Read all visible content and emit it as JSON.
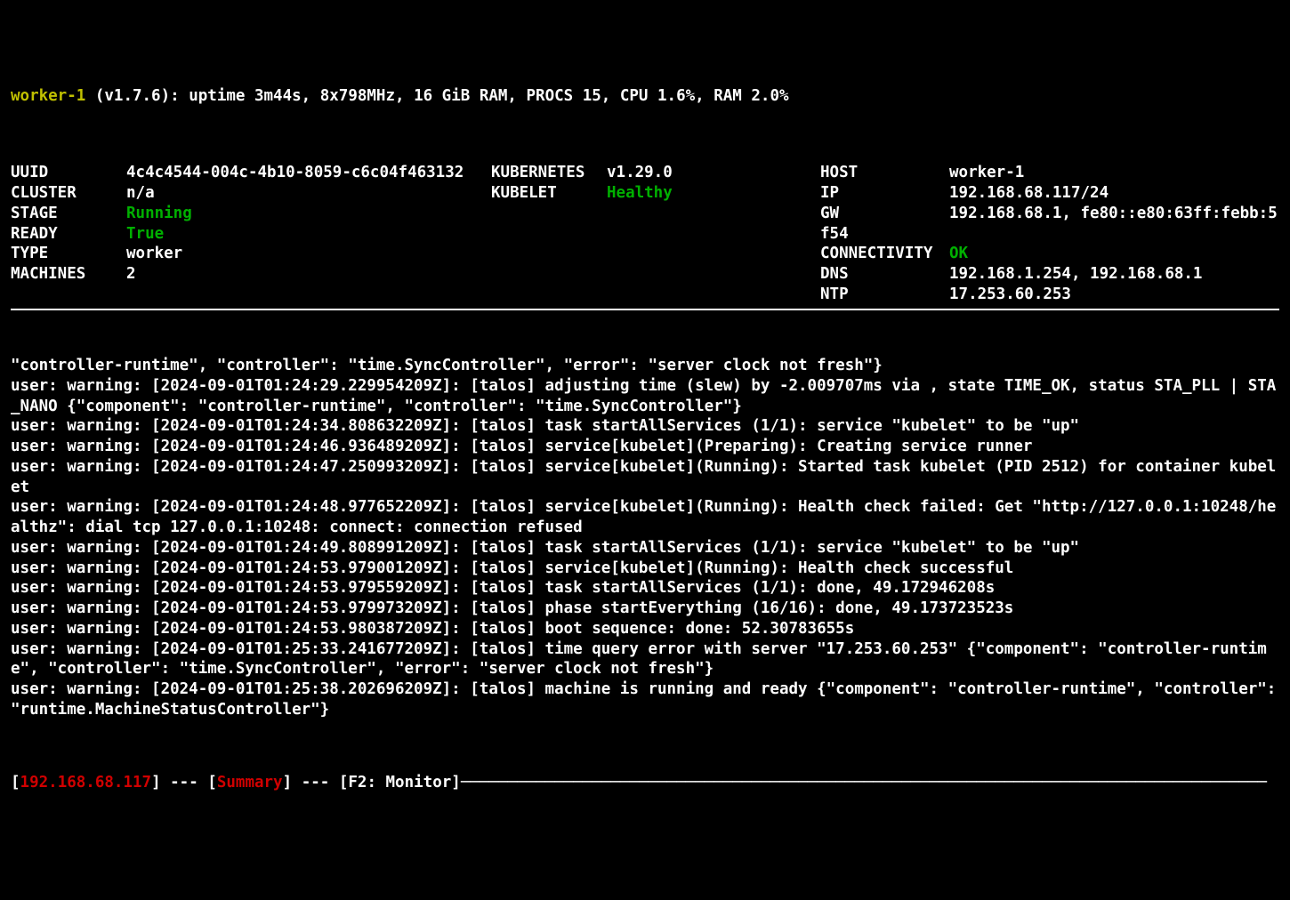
{
  "header": {
    "hostname": "worker-1",
    "version": "v1.7.6",
    "stats": ": uptime 3m44s, 8x798MHz, 16 GiB RAM, PROCS 15, CPU 1.6%, RAM 2.0%"
  },
  "col1": {
    "uuid_label": "UUID",
    "uuid_value": "4c4c4544-004c-4b10-8059-c6c04f463132",
    "cluster_label": "CLUSTER",
    "cluster_value": "n/a",
    "stage_label": "STAGE",
    "stage_value": "Running",
    "ready_label": "READY",
    "ready_value": "True",
    "type_label": "TYPE",
    "type_value": "worker",
    "machines_label": "MACHINES",
    "machines_value": "2"
  },
  "col2": {
    "k8s_label": "KUBERNETES",
    "k8s_value": "v1.29.0",
    "kubelet_label": "KUBELET",
    "kubelet_value": "Healthy"
  },
  "col3": {
    "host_label": "HOST",
    "host_value": "worker-1",
    "ip_label": "IP",
    "ip_value": "192.168.68.117/24",
    "gw_label": "GW",
    "gw_value": "192.168.68.1, fe80::e80:63ff:febb:5f54",
    "conn_label": "CONNECTIVITY",
    "conn_value": "OK",
    "dns_label": "DNS",
    "dns_value": "192.168.1.254, 192.168.68.1",
    "ntp_label": "NTP",
    "ntp_value": "17.253.60.253"
  },
  "logs": "\"controller-runtime\", \"controller\": \"time.SyncController\", \"error\": \"server clock not fresh\"}\nuser: warning: [2024-09-01T01:24:29.229954209Z]: [talos] adjusting time (slew) by -2.009707ms via , state TIME_OK, status STA_PLL | STA_NANO {\"component\": \"controller-runtime\", \"controller\": \"time.SyncController\"}\nuser: warning: [2024-09-01T01:24:34.808632209Z]: [talos] task startAllServices (1/1): service \"kubelet\" to be \"up\"\nuser: warning: [2024-09-01T01:24:46.936489209Z]: [talos] service[kubelet](Preparing): Creating service runner\nuser: warning: [2024-09-01T01:24:47.250993209Z]: [talos] service[kubelet](Running): Started task kubelet (PID 2512) for container kubelet\nuser: warning: [2024-09-01T01:24:48.977652209Z]: [talos] service[kubelet](Running): Health check failed: Get \"http://127.0.0.1:10248/healthz\": dial tcp 127.0.0.1:10248: connect: connection refused\nuser: warning: [2024-09-01T01:24:49.808991209Z]: [talos] task startAllServices (1/1): service \"kubelet\" to be \"up\"\nuser: warning: [2024-09-01T01:24:53.979001209Z]: [talos] service[kubelet](Running): Health check successful\nuser: warning: [2024-09-01T01:24:53.979559209Z]: [talos] task startAllServices (1/1): done, 49.172946208s\nuser: warning: [2024-09-01T01:24:53.979973209Z]: [talos] phase startEverything (16/16): done, 49.173723523s\nuser: warning: [2024-09-01T01:24:53.980387209Z]: [talos] boot sequence: done: 52.30783655s\nuser: warning: [2024-09-01T01:25:33.241677209Z]: [talos] time query error with server \"17.253.60.253\" {\"component\": \"controller-runtime\", \"controller\": \"time.SyncController\", \"error\": \"server clock not fresh\"}\nuser: warning: [2024-09-01T01:25:38.202696209Z]: [talos] machine is running and ready {\"component\": \"controller-runtime\", \"controller\": \"runtime.MachineStatusController\"}",
  "footer": {
    "open1": "[",
    "ip": "192.168.68.117",
    "close1": "]",
    "sep1": " --- ",
    "open2": "[",
    "tab": "Summary",
    "close2": "]",
    "sep2": " --- ",
    "monitor": "[F2: Monitor]",
    "tail": "──────────────────────────────────────────────────────────────────────────────────────"
  }
}
